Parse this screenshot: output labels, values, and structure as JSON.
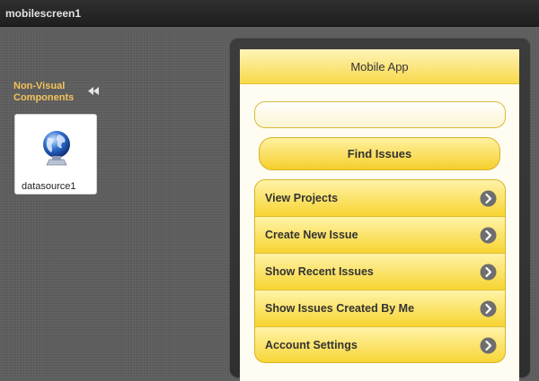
{
  "window": {
    "title": "mobilescreen1"
  },
  "sidebar": {
    "non_visual_label_line1": "Non-Visual",
    "non_visual_label_line2": "Components",
    "collapse_icon": "double-chevron-left-icon",
    "components": [
      {
        "label": "datasource1",
        "icon": "globe-datasource-icon"
      }
    ]
  },
  "mobile": {
    "header_title": "Mobile App",
    "search": {
      "value": "",
      "placeholder": ""
    },
    "find_button_label": "Find Issues",
    "menu_items": [
      {
        "label": "View Projects",
        "icon": "chevron-right-circle-icon"
      },
      {
        "label": "Create New Issue",
        "icon": "chevron-right-circle-icon"
      },
      {
        "label": "Show Recent Issues",
        "icon": "chevron-right-circle-icon"
      },
      {
        "label": "Show Issues Created By Me",
        "icon": "chevron-right-circle-icon"
      },
      {
        "label": "Account Settings",
        "icon": "chevron-right-circle-icon"
      }
    ]
  },
  "colors": {
    "accent_yellow": "#f8d94a",
    "sidebar_label": "#f3c35a",
    "background": "#5f5f5f"
  }
}
